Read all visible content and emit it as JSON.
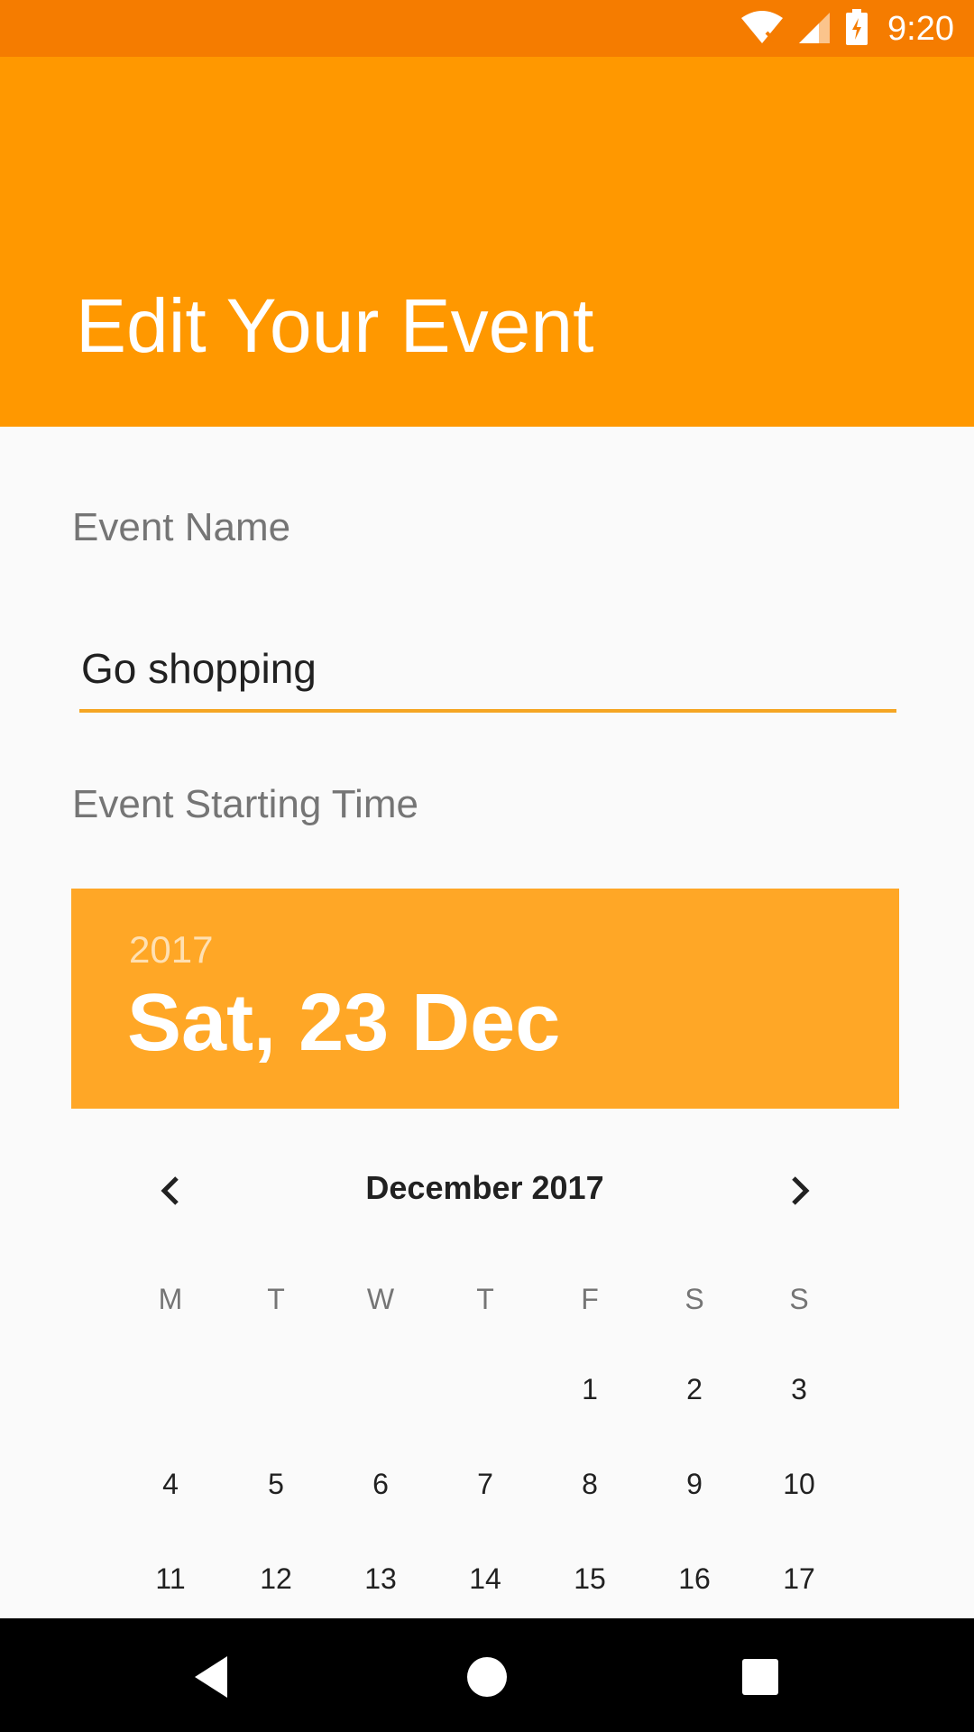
{
  "status_bar": {
    "time": "9:20"
  },
  "app_bar": {
    "title": "Edit Your Event"
  },
  "form": {
    "event_name_label": "Event Name",
    "event_name_value": "Go shopping",
    "start_time_label": "Event Starting Time"
  },
  "date_picker": {
    "year": "2017",
    "selected_date": "Sat, 23 Dec",
    "month_title": "December 2017",
    "weekdays": [
      "M",
      "T",
      "W",
      "T",
      "F",
      "S",
      "S"
    ],
    "week1": [
      "1",
      "2",
      "3"
    ],
    "week2": [
      "4",
      "5",
      "6",
      "7",
      "8",
      "9",
      "10"
    ],
    "week3": [
      "11",
      "12",
      "13",
      "14",
      "15",
      "16",
      "17"
    ]
  },
  "colors": {
    "status_bar": "#f57c00",
    "primary": "#ff9800",
    "picker_header": "#ffa726",
    "input_underline": "#f5a623"
  }
}
